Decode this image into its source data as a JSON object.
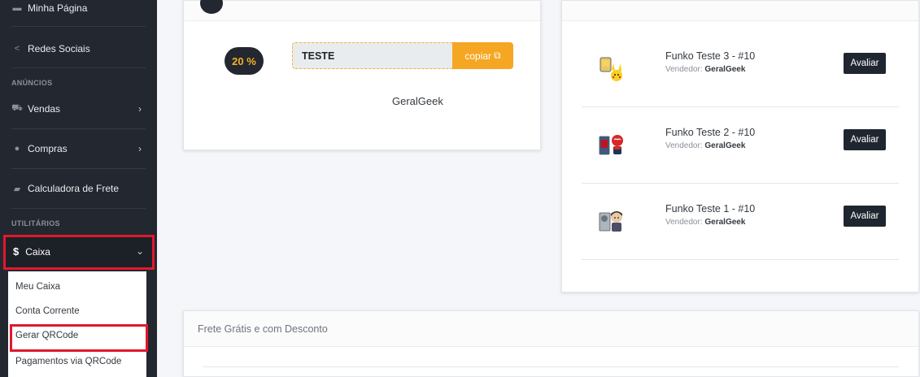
{
  "sidebar": {
    "top_partial": "Minha Página",
    "redes_sociais": "Redes Sociais",
    "section_anuncios": "ANÚNCIOS",
    "vendas": "Vendas",
    "compras": "Compras",
    "calculadora": "Calculadora de Frete",
    "section_utilitarios": "UTILITÁRIOS",
    "caixa": "Caixa",
    "submenu": [
      "Meu Caixa",
      "Conta Corrente",
      "Gerar QRCode",
      "Pagamentos via QRCode"
    ]
  },
  "coupon": {
    "discount": "20 %",
    "code": "TESTE",
    "copy_label": "copiar",
    "seller": "GeralGeek"
  },
  "products": [
    {
      "title": "Funko Teste 3 - #10",
      "vendor_label": "Vendedor:",
      "vendor": "GeralGeek",
      "button": "Avaliar"
    },
    {
      "title": "Funko Teste 2 - #10",
      "vendor_label": "Vendedor:",
      "vendor": "GeralGeek",
      "button": "Avaliar"
    },
    {
      "title": "Funko Teste 1 - #10",
      "vendor_label": "Vendedor:",
      "vendor": "GeralGeek",
      "button": "Avaliar"
    }
  ],
  "bottom_card": {
    "title": "Frete Grátis e com Desconto"
  },
  "colors": {
    "sidebar_bg": "#23272f",
    "accent_yellow": "#f5a623",
    "highlight_red": "#e0192d",
    "button_dark": "#1f2630"
  }
}
